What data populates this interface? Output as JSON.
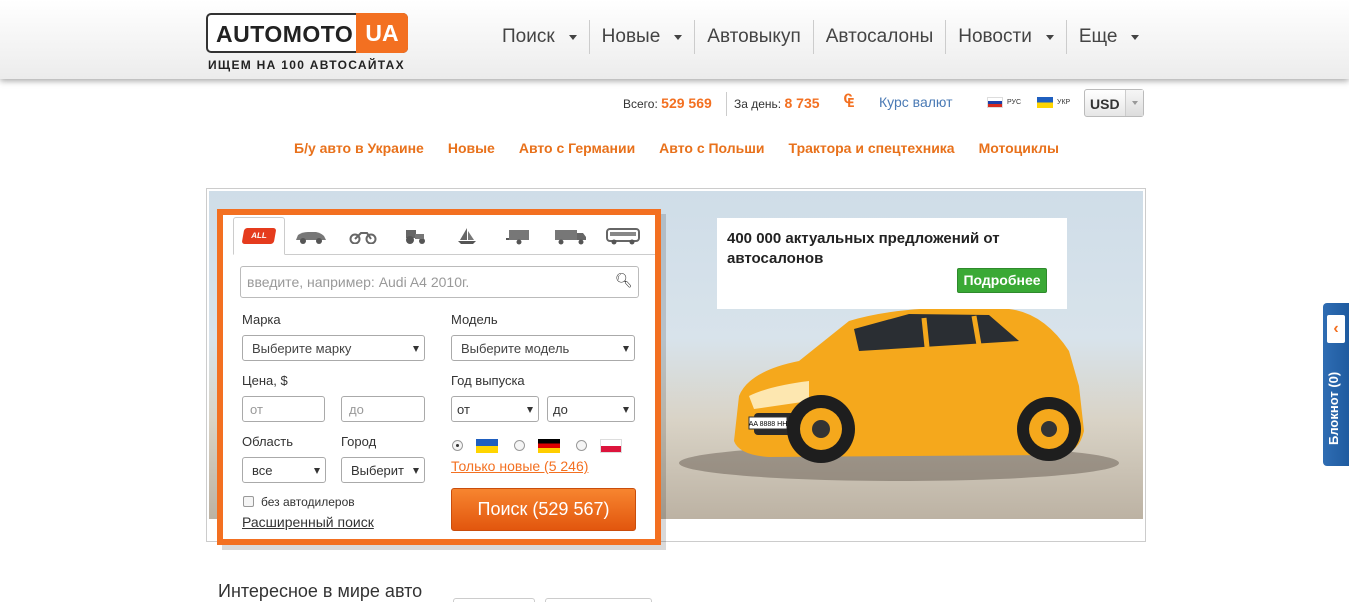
{
  "header": {
    "logo_main": "AUTOMOTO",
    "logo_ua": "UA",
    "tagline": "ИЩЕМ НА 100 АВТОСАЙТАХ",
    "nav": [
      {
        "label": "Поиск",
        "dropdown": true
      },
      {
        "label": "Новые",
        "dropdown": true
      },
      {
        "label": "Автовыкуп",
        "dropdown": false
      },
      {
        "label": "Автосалоны",
        "dropdown": false
      },
      {
        "label": "Новости",
        "dropdown": true
      },
      {
        "label": "Еще",
        "dropdown": true
      }
    ]
  },
  "stats": {
    "total_label": "Всего:",
    "total_value": "529 569",
    "day_label": "За день:",
    "day_value": "8 735",
    "rates_link": "Курс валют",
    "lang_ru": "РУС",
    "lang_ua": "УКР",
    "currency": "USD"
  },
  "categories": [
    "Б/у авто в Украине",
    "Новые",
    "Авто с Германии",
    "Авто с Польши",
    "Трактора и спецтехника",
    "Мотоциклы"
  ],
  "promo": {
    "text": "400 000 актуальных предложений от автосалонов",
    "button": "Подробнее",
    "plate": "AA 8888 HH"
  },
  "search": {
    "tab_all_label": "ALL",
    "tabs": [
      "all",
      "car",
      "moto",
      "tractor",
      "boat",
      "trailer",
      "truck",
      "bus"
    ],
    "placeholder": "введите, например: Audi A4 2010г.",
    "make_label": "Марка",
    "make_value": "Выберите марку",
    "model_label": "Модель",
    "model_value": "Выберите модель",
    "price_label": "Цена, $",
    "price_from": "от",
    "price_to": "до",
    "year_label": "Год выпуска",
    "year_from": "от",
    "year_to": "до",
    "region_label": "Область",
    "region_value": "все",
    "city_label": "Город",
    "city_value": "Выберит",
    "only_new": "Только новые (5 246)",
    "no_dealers": "без автодилеров",
    "advanced": "Расширенный поиск",
    "button": "Поиск (529 567)"
  },
  "notebook": {
    "label": "Блокнот (0)"
  },
  "section_title": "Интересное в мире авто",
  "colors": {
    "accent": "#f37021",
    "link_blue": "#4a7ab5",
    "green": "#3aa935",
    "notebook_blue": "#2f6db3"
  }
}
